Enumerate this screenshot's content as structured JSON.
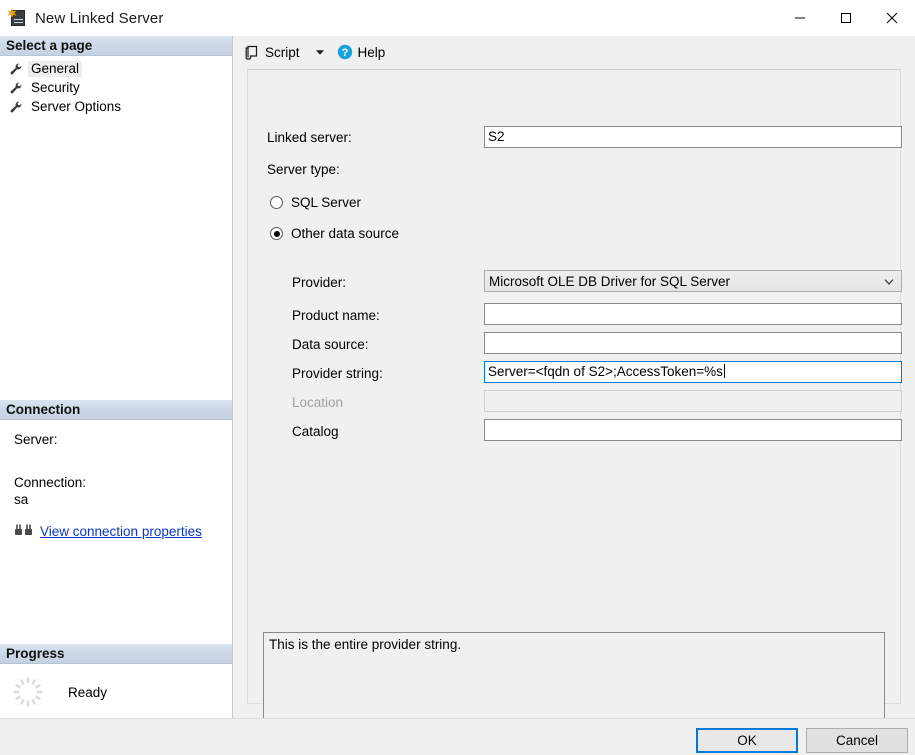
{
  "window": {
    "title": "New Linked Server",
    "icon": "new-linked-server-icon",
    "minimize_label": "Minimize",
    "maximize_label": "Maximize",
    "close_label": "Close"
  },
  "sidebar": {
    "header": "Select a page",
    "items": [
      {
        "label": "General",
        "icon": "wrench-icon",
        "selected": true
      },
      {
        "label": "Security",
        "icon": "wrench-icon",
        "selected": false
      },
      {
        "label": "Server Options",
        "icon": "wrench-icon",
        "selected": false
      }
    ]
  },
  "connection": {
    "header": "Connection",
    "server_label": "Server:",
    "server_value": "",
    "connection_label": "Connection:",
    "connection_value": "sa",
    "link_label": "View connection properties",
    "link_icon": "plug-icon",
    "link_color": "#0b35c4"
  },
  "progress": {
    "header": "Progress",
    "status": "Ready",
    "spinner_icon": "spinner-icon"
  },
  "toolbar": {
    "script_label": "Script",
    "script_icon": "script-icon",
    "dropdown_icon": "chevron-down-icon",
    "help_label": "Help",
    "help_icon": "help-circle-icon",
    "help_color": "#0ea5e9"
  },
  "form": {
    "linked_server_label": "Linked server:",
    "linked_server_value": "S2",
    "server_type_label": "Server type:",
    "radio_sql_server": "SQL Server",
    "radio_other_data_source": "Other data source",
    "selected_server_type": "Other data source",
    "provider_label": "Provider:",
    "provider_value": "Microsoft OLE DB Driver for SQL Server",
    "product_name_label": "Product name:",
    "product_name_value": "",
    "data_source_label": "Data source:",
    "data_source_value": "",
    "provider_string_label": "Provider string:",
    "provider_string_value": "Server=<fqdn of S2>;AccessToken=%s",
    "location_label": "Location",
    "location_value": "",
    "location_disabled": true,
    "catalog_label": "Catalog",
    "catalog_value": ""
  },
  "description": {
    "text": "This is the entire provider string."
  },
  "footer": {
    "ok_label": "OK",
    "cancel_label": "Cancel",
    "accent_color": "#0078d7"
  }
}
